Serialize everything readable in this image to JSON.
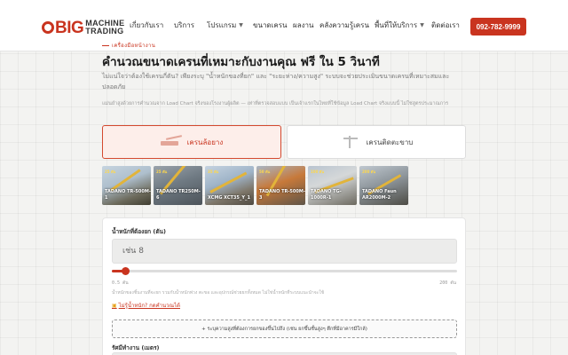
{
  "brand": {
    "big": "BIG",
    "line1": "MACHINE",
    "line2": "TRADING",
    "accent": "#c9341f"
  },
  "nav": {
    "items": [
      {
        "label": "เกี่ยวกับเรา",
        "dropdown": false
      },
      {
        "label": "บริการ",
        "dropdown": false
      },
      {
        "label": "โปรแกรม",
        "dropdown": true
      },
      {
        "label": "ขนาดเครน",
        "dropdown": false
      },
      {
        "label": "ผลงาน",
        "dropdown": false
      },
      {
        "label": "คลังความรู้เครน",
        "dropdown": false
      },
      {
        "label": "พื้นที่ให้บริการ",
        "dropdown": true
      },
      {
        "label": "ติดต่อเรา",
        "dropdown": false
      }
    ],
    "phone": "092-782-9999"
  },
  "hero": {
    "tag": "เครื่องมือหน้างาน",
    "title": "คำนวณขนาดเครนที่เหมาะกับงานคุณ ฟรี ใน 5 วินาที",
    "subtitle": "ไม่แน่ใจว่าต้องใช้เครนกี่ตัน? เพียงระบุ \"น้ำหนักของที่ยก\" และ \"ระยะห่าง/ความสูง\" ระบบจะช่วยประเมินขนาดเครนที่เหมาะสมและปลอดภัย",
    "note": "แม่นยำสูงด้วยการคำนวณจาก Load Chart จริงของโรงงานผู้ผลิต — เท่าที่ตรวจสอบแบบ เป็นเจ้าแรกในไทยที่ใช้ข้อมูล Load Chart จริงแบบนี้ ไม่ใช่สูตรประมาณการ"
  },
  "crane_types": [
    {
      "label": "เครนล้อยาง",
      "icon": "truck-crane-icon",
      "active": true
    },
    {
      "label": "เครนติดตะขาบ",
      "icon": "tower-crane-icon",
      "active": false
    }
  ],
  "gallery": [
    {
      "label": "TADANO TR-500M-1",
      "badge": "25 ตัน"
    },
    {
      "label": "TADANO TR250M-6",
      "badge": "25 ตัน"
    },
    {
      "label": "XCMG XCT35_Y_1",
      "badge": "35 ตัน"
    },
    {
      "label": "TADANO TR-500M-3",
      "badge": "50 ตัน"
    },
    {
      "label": "TADANO TG-1000R-1",
      "badge": "100 ตัน"
    },
    {
      "label": "TADANO Faun AR2000M-2",
      "badge": "200 ตัน"
    }
  ],
  "form": {
    "weight_label": "น้ำหนักที่ต้องยก (ตัน)",
    "weight_placeholder": "เช่น 8",
    "slider": {
      "min": 0.5,
      "max": 200,
      "value": 8
    },
    "min_label": "0.5 ตัน",
    "max_label": "200 ตัน",
    "help": "น้ำหนักของชิ้นงานที่จะยก รวมกับน้ำหนักพ่วง ตะขอ และอุปกรณ์ช่วยยกทั้งหมด ไม่ใช่น้ำหนักที่ระบบแนะนำจะใช้",
    "help_link": "ไม่รู้น้ำหนัก? กดคำนวณได้",
    "add_button": "+ ระบุความสูงที่ต้องการยกของขึ้นไปถึง (เช่น ยกขึ้นชั้นสูงๆ ตึกที่มีอาคารมีใกล้)",
    "radius_label": "รัศมีทำงาน (เมตร)"
  }
}
